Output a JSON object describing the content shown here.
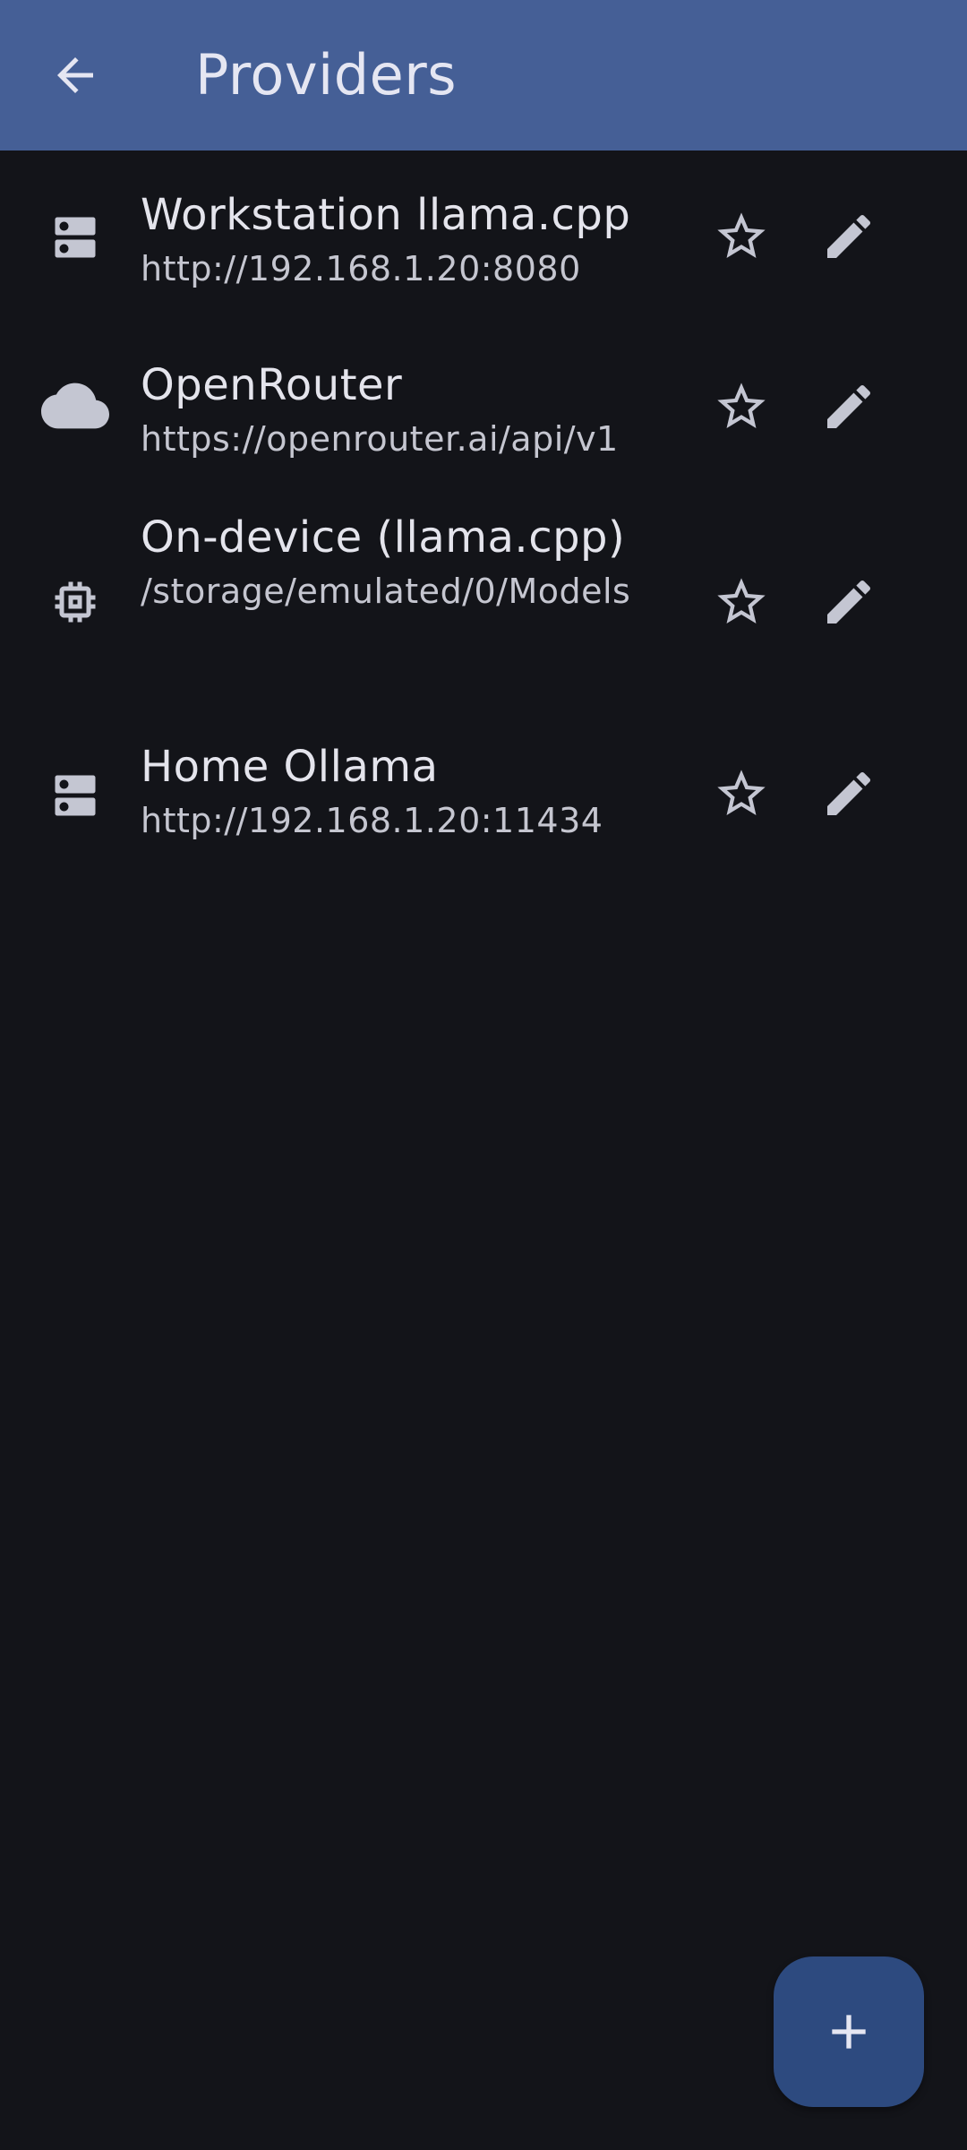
{
  "app_bar": {
    "title": "Providers",
    "back_icon": "arrow-back-icon"
  },
  "providers": [
    {
      "name": "Workstation llama.cpp",
      "address": "http://192.168.1.20:8080",
      "icon": "server-icon",
      "favorite": false
    },
    {
      "name": "OpenRouter",
      "address": "https://openrouter.ai/api/v1",
      "icon": "cloud-icon",
      "favorite": false
    },
    {
      "name": "On-device (llama.cpp)",
      "address": "/storage/emulated/0/Models",
      "icon": "chip-icon",
      "favorite": false
    },
    {
      "name": "Home Ollama",
      "address": "http://192.168.1.20:11434",
      "icon": "server-icon",
      "favorite": false
    }
  ],
  "fab": {
    "icon": "add-icon"
  },
  "colors": {
    "app_bar": "#455f96",
    "background": "#131419",
    "fab": "#2d4a7f",
    "icon": "#c4c6d2"
  }
}
